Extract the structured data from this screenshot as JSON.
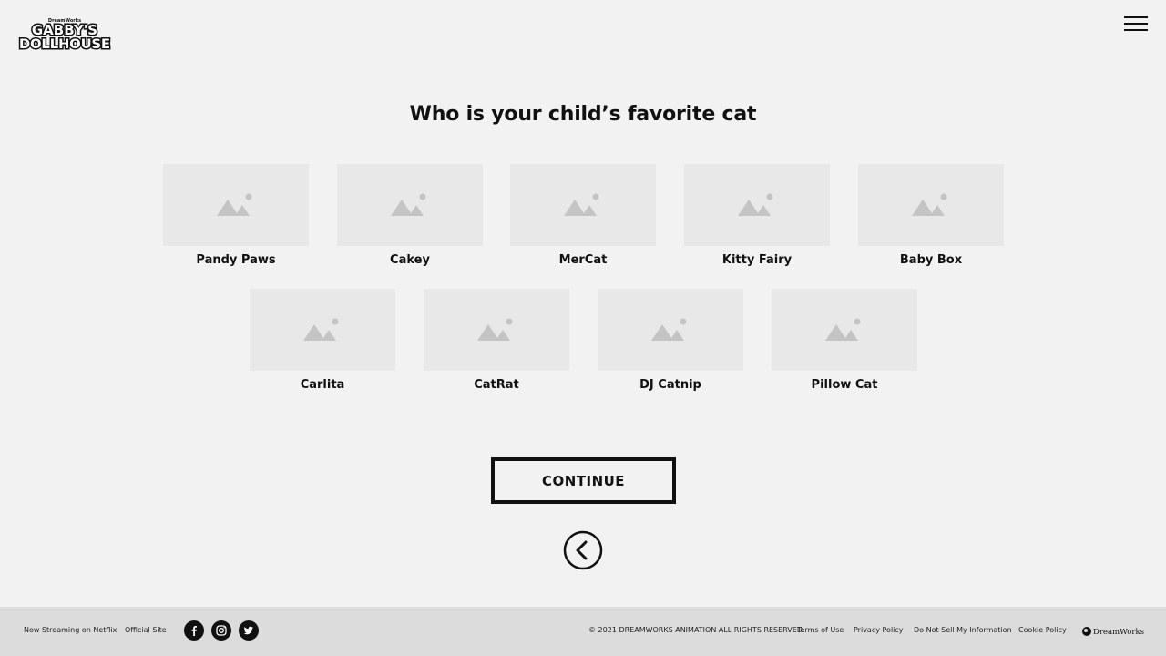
{
  "header": {
    "logo_alt": "Gabby's Dollhouse",
    "logo_small_text": "DreamWorks",
    "logo_line1": "GABBY'S",
    "logo_line2": "DOLLHOUSE",
    "menu_icon": "hamburger-menu-icon"
  },
  "quiz": {
    "question": "Who is your child’s favorite cat",
    "cards": [
      {
        "label": "Pandy Paws",
        "icon": "image-placeholder-icon"
      },
      {
        "label": "Cakey",
        "icon": "image-placeholder-icon"
      },
      {
        "label": "MerCat",
        "icon": "image-placeholder-icon"
      },
      {
        "label": "Kitty Fairy",
        "icon": "image-placeholder-icon"
      },
      {
        "label": "Baby Box",
        "icon": "image-placeholder-icon"
      },
      {
        "label": "Carlita",
        "icon": "image-placeholder-icon"
      },
      {
        "label": "CatRat",
        "icon": "image-placeholder-icon"
      },
      {
        "label": "DJ Catnip",
        "icon": "image-placeholder-icon"
      },
      {
        "label": "Pillow Cat",
        "icon": "image-placeholder-icon"
      }
    ],
    "continue_label": "CONTINUE",
    "back_icon": "chevron-left-circle-icon"
  },
  "footer": {
    "streaming": "Now Streaming on Netflix",
    "official_site": "Official Site",
    "social": [
      "facebook-icon",
      "instagram-icon",
      "twitter-icon"
    ],
    "copyright": "© 2021 DREAMWORKS ANIMATION ALL RIGHTS RESERVED.",
    "terms": "Terms of Use",
    "privacy": "Privacy Policy",
    "do_not_sell": "Do Not Sell My Information",
    "cookie": "Cookie Policy",
    "brand": "DreamWorks"
  },
  "colors": {
    "background": "#f2f2f2",
    "footer_bg": "#dcdcdc",
    "card_bg": "#e8e8e8",
    "placeholder_icon": "#c4c4c4",
    "text": "#111111"
  }
}
